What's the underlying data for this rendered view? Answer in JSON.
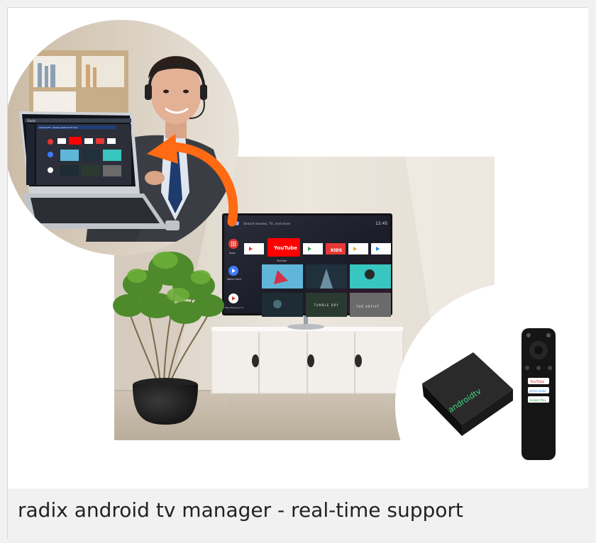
{
  "caption": "radix android tv manager - real-time support",
  "tv": {
    "search_hint": "Search movies, TV, and more",
    "time": "12:45",
    "row_labels": [
      "Apps",
      "Watch Next",
      "Play Movies & TV"
    ],
    "youtube_label": "YouTube",
    "youtube_caption": "YouTube",
    "kids_label": "KIDS",
    "thumb_text": "TUMBLE DRY",
    "thumb_text2": "THE ARTIST"
  },
  "laptop": {
    "window_title": "Radix",
    "device_title": "Android TV • Radix (Android TV 9.0)"
  },
  "remote": {
    "buttons": [
      "YouTube",
      "prime video",
      "Google Play"
    ]
  },
  "box": {
    "brand": "androidtv"
  },
  "colors": {
    "arrow": "#ff6a13",
    "tv_bg": "#1c1f26",
    "wall": "#e9e2d8"
  }
}
